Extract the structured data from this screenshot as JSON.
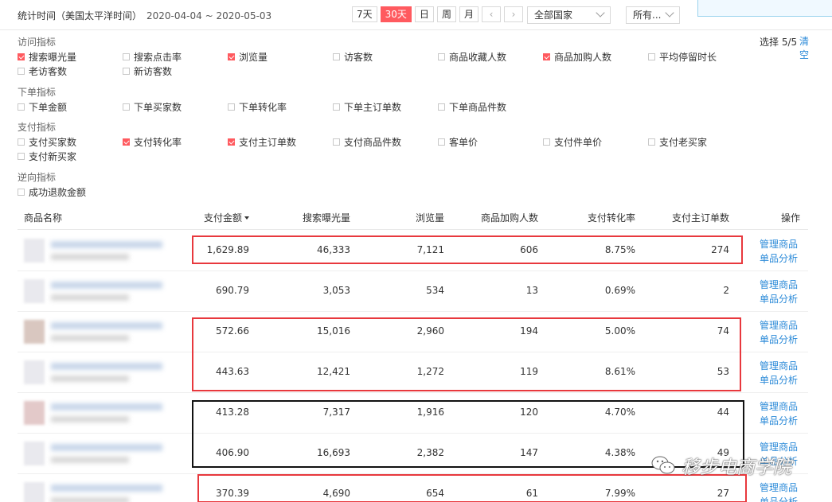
{
  "header": {
    "stat_time_label": "统计时间（美国太平洋时间）",
    "date_range": "2020-04-04 ~ 2020-05-03",
    "periods": [
      "7天",
      "30天",
      "日",
      "周",
      "月"
    ],
    "active_period": "30天",
    "prev_icon": "chevron-left-icon",
    "next_icon": "chevron-right-icon",
    "country_select": "全部国家",
    "all_select": "所有..."
  },
  "metrics": {
    "selected_count": "选择 5/5",
    "clear": "清空",
    "groups": [
      {
        "title": "访问指标",
        "items": [
          {
            "label": "搜索曝光量",
            "checked": true
          },
          {
            "label": "搜索点击率",
            "checked": false
          },
          {
            "label": "浏览量",
            "checked": true
          },
          {
            "label": "访客数",
            "checked": false
          },
          {
            "label": "商品收藏人数",
            "checked": false
          },
          {
            "label": "商品加购人数",
            "checked": true
          },
          {
            "label": "平均停留时长",
            "checked": false
          },
          {
            "label": "老访客数",
            "checked": false
          },
          {
            "label": "新访客数",
            "checked": false
          }
        ]
      },
      {
        "title": "下单指标",
        "items": [
          {
            "label": "下单金额",
            "checked": false
          },
          {
            "label": "下单买家数",
            "checked": false
          },
          {
            "label": "下单转化率",
            "checked": false
          },
          {
            "label": "下单主订单数",
            "checked": false
          },
          {
            "label": "下单商品件数",
            "checked": false
          }
        ]
      },
      {
        "title": "支付指标",
        "items": [
          {
            "label": "支付买家数",
            "checked": false
          },
          {
            "label": "支付转化率",
            "checked": true
          },
          {
            "label": "支付主订单数",
            "checked": true
          },
          {
            "label": "支付商品件数",
            "checked": false
          },
          {
            "label": "客单价",
            "checked": false
          },
          {
            "label": "支付件单价",
            "checked": false
          },
          {
            "label": "支付老买家",
            "checked": false
          },
          {
            "label": "支付新买家",
            "checked": false
          }
        ]
      },
      {
        "title": "逆向指标",
        "items": [
          {
            "label": "成功退款金额",
            "checked": false
          }
        ]
      }
    ]
  },
  "table": {
    "columns": {
      "name": "商品名称",
      "pay_amount": "支付金额",
      "exposure": "搜索曝光量",
      "views": "浏览量",
      "cart": "商品加购人数",
      "conv": "支付转化率",
      "orders": "支付主订单数",
      "ops": "操作"
    },
    "ops_labels": {
      "manage": "管理商品",
      "analysis": "单品分析"
    },
    "rows": [
      {
        "pay": "1,629.89",
        "exposure": "46,333",
        "views": "7,121",
        "cart": "606",
        "conv": "8.75%",
        "orders": "274"
      },
      {
        "pay": "690.79",
        "exposure": "3,053",
        "views": "534",
        "cart": "13",
        "conv": "0.69%",
        "orders": "2"
      },
      {
        "pay": "572.66",
        "exposure": "15,016",
        "views": "2,960",
        "cart": "194",
        "conv": "5.00%",
        "orders": "74"
      },
      {
        "pay": "443.63",
        "exposure": "12,421",
        "views": "1,272",
        "cart": "119",
        "conv": "8.61%",
        "orders": "53"
      },
      {
        "pay": "413.28",
        "exposure": "7,317",
        "views": "1,916",
        "cart": "120",
        "conv": "4.70%",
        "orders": "44"
      },
      {
        "pay": "406.90",
        "exposure": "16,693",
        "views": "2,382",
        "cart": "147",
        "conv": "4.38%",
        "orders": "49"
      },
      {
        "pay": "370.39",
        "exposure": "4,690",
        "views": "654",
        "cart": "61",
        "conv": "7.99%",
        "orders": "27"
      }
    ]
  },
  "watermark": {
    "text": "移步电商学院",
    "icon": "wechat-icon"
  },
  "colors": {
    "accent": "#ff5a5f",
    "link": "#2b8ad8",
    "highlight_red": "#e8383d",
    "highlight_black": "#111111"
  }
}
